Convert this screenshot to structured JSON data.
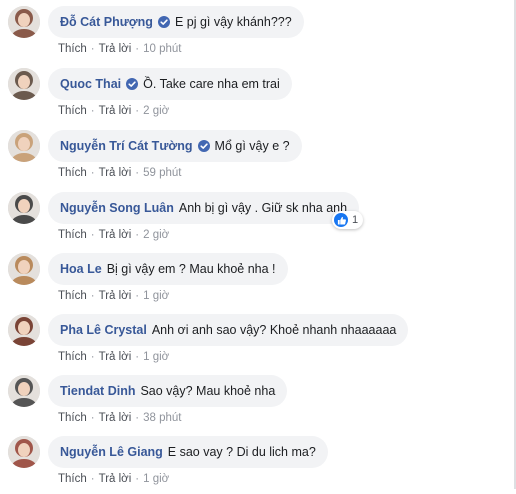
{
  "comments": [
    {
      "author": "Đỗ Cát Phượng",
      "verified": true,
      "text": "E pj gì vậy khánh???",
      "like_label": "Thích",
      "reply_label": "Trả lời",
      "time": "10 phút",
      "avatar_color": "#8a5a4a"
    },
    {
      "author": "Quoc Thai",
      "verified": true,
      "text": "Ồ. Take care nha em trai",
      "like_label": "Thích",
      "reply_label": "Trả lời",
      "time": "2 giờ",
      "avatar_color": "#6b5a4e"
    },
    {
      "author": "Nguyễn Trí Cát Tường",
      "verified": true,
      "text": "Mổ gì vậy e ?",
      "like_label": "Thích",
      "reply_label": "Trả lời",
      "time": "59 phút",
      "avatar_color": "#c9a27a"
    },
    {
      "author": "Nguyễn Song Luân",
      "verified": false,
      "text": "Anh bị gì vậy . Giữ sk nha anh",
      "like_label": "Thích",
      "reply_label": "Trả lời",
      "time": "2 giờ",
      "avatar_color": "#4a4a4a",
      "reaction_count": "1"
    },
    {
      "author": "Hoa Le",
      "verified": false,
      "text": "Bị gì vậy em ? Mau khoẻ nha !",
      "like_label": "Thích",
      "reply_label": "Trả lời",
      "time": "1 giờ",
      "avatar_color": "#b98a5c"
    },
    {
      "author": "Pha Lê Crystal",
      "verified": false,
      "text": "Anh ơi anh sao vậy? Khoẻ nhanh nhaaaaaa",
      "like_label": "Thích",
      "reply_label": "Trả lời",
      "time": "1 giờ",
      "avatar_color": "#7a4436"
    },
    {
      "author": "Tiendat Dinh",
      "verified": false,
      "text": "Sao vậy? Mau khoẻ nha",
      "like_label": "Thích",
      "reply_label": "Trả lời",
      "time": "38 phút",
      "avatar_color": "#555555"
    },
    {
      "author": "Nguyễn Lê Giang",
      "verified": false,
      "text": "E sao vay ? Di du lich ma?",
      "like_label": "Thích",
      "reply_label": "Trả lời",
      "time": "1 giờ",
      "avatar_color": "#a0564a"
    }
  ],
  "colors": {
    "author": "#385898",
    "bubble": "#f2f3f5",
    "verified_badge": "#4267b2",
    "like_reaction": "#1877f2",
    "meta": "#90949c"
  }
}
